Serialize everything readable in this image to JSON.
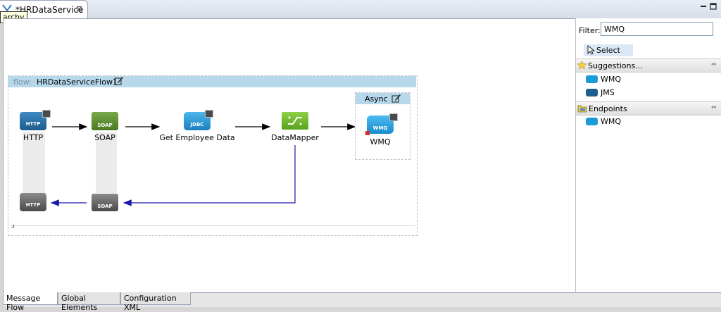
{
  "editor": {
    "tab_title": "*HRDataService",
    "tab_close": "⊠",
    "tooltip": "archy"
  },
  "flow": {
    "prefix": "flow:",
    "name": "HRDataServiceFlow1",
    "nodes": [
      {
        "label": "HTTP",
        "icon_text": "HTTP"
      },
      {
        "label": "SOAP",
        "icon_text": "SOAP"
      },
      {
        "label": "Get Employee Data",
        "icon_text": "JDBC"
      },
      {
        "label": "DataMapper",
        "icon_text": ""
      }
    ],
    "return_nodes": [
      {
        "icon_text": "HTTP"
      },
      {
        "icon_text": "SOAP"
      }
    ],
    "async": {
      "label": "Async",
      "node_label": "WMQ",
      "node_icon_text": "WMQ"
    }
  },
  "palette": {
    "filter_label": "Filter:",
    "filter_value": "WMQ",
    "select_label": "Select",
    "suggestions": {
      "title": "Suggestions...",
      "items": [
        {
          "label": "WMQ",
          "color": "#1a9ad6"
        },
        {
          "label": "JMS",
          "color": "#1c5f8c"
        }
      ]
    },
    "endpoints": {
      "title": "Endpoints",
      "items": [
        {
          "label": "WMQ",
          "color": "#1a9ad6"
        }
      ]
    },
    "collapse_glyph": "⇔"
  },
  "bottom_tabs": [
    "Message Flow",
    "Global Elements",
    "Configuration XML"
  ],
  "colors": {
    "connector": "#000000",
    "return_connector": "#1a1aa8",
    "flow_header": "#b7d7ea",
    "http_icon": "#2a6ea0",
    "soap_icon": "#5c8a2c",
    "jdbc_icon": "#1f8fd0",
    "datamapper_icon": "#6cb62c",
    "wmq_icon": "#1a9ad6"
  }
}
